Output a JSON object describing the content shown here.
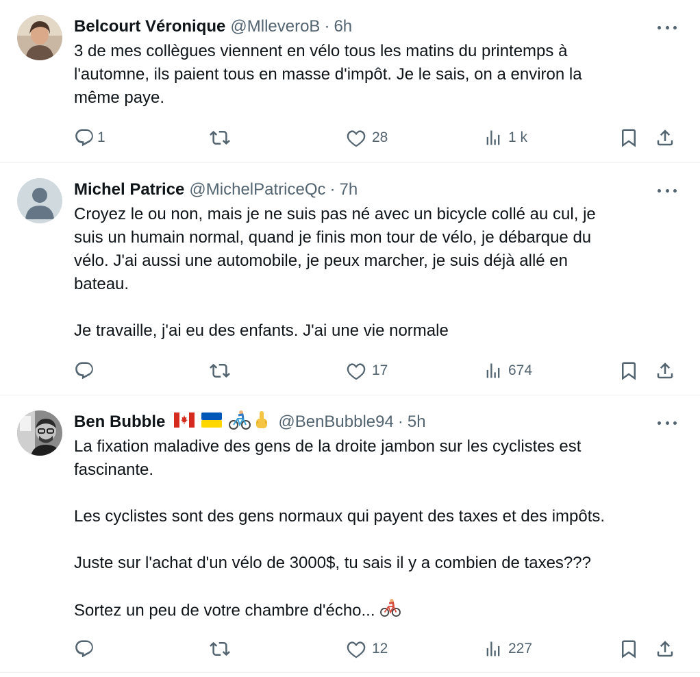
{
  "tweets": [
    {
      "name": "Belcourt Véronique",
      "handle": "@MlleveroB",
      "separator": "·",
      "time": "6h",
      "lines": [
        "3 de mes collègues viennent en vélo tous les matins du printemps à",
        "l'automne, ils paient tous en masse d'impôt. Je le sais, on a environ la",
        "même paye."
      ],
      "replies": "1",
      "reposts": "",
      "likes": "28",
      "views": "1 k"
    },
    {
      "name": "Michel Patrice",
      "handle": "@MichelPatriceQc",
      "separator": "·",
      "time": "7h",
      "lines": [
        "Croyez le ou non, mais je ne suis pas né avec un bicycle collé au cul, je",
        "suis un humain normal, quand je finis mon tour de vélo, je débarque du",
        "vélo. J'ai aussi une automobile, je peux marcher, je suis déjà allé en",
        "bateau.",
        "",
        "Je travaille, j'ai eu des enfants. J'ai une vie normale"
      ],
      "replies": "",
      "reposts": "",
      "likes": "17",
      "views": "674"
    },
    {
      "name": "Ben Bubble",
      "handle": "@BenBubble94",
      "separator": "·",
      "time": "5h",
      "lines": [
        "La fixation maladive des gens de la droite jambon sur les cyclistes est",
        "fascinante.",
        "",
        "Les cyclistes sont des gens normaux qui payent des taxes et des impôts.",
        "",
        "Juste sur l'achat d'un vélo de 3000$, tu sais il y a combien de taxes???",
        "",
        "Sortez un peu de votre chambre d'écho..."
      ],
      "replies": "",
      "reposts": "",
      "likes": "12",
      "views": "227"
    }
  ],
  "colors": {
    "text": "#0f1419",
    "secondary": "#536471",
    "divider": "#eff3f4"
  },
  "icons": [
    "reply-icon",
    "repost-icon",
    "like-icon",
    "views-icon",
    "bookmark-icon",
    "share-icon",
    "more-icon",
    "canada-flag-icon",
    "ukraine-flag-icon",
    "cyclist-icon",
    "raised-finger-icon"
  ]
}
